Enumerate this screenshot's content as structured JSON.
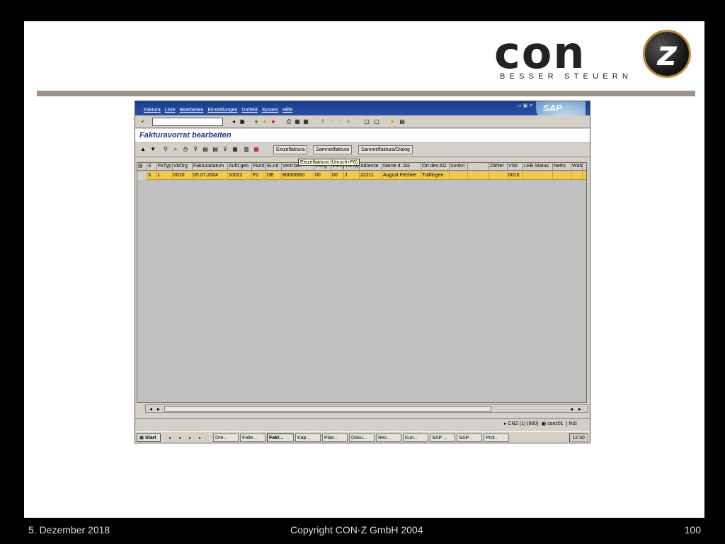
{
  "logo": {
    "name": "con",
    "letter": "z",
    "tagline": "BESSER STEUERN"
  },
  "sap": {
    "menu": [
      "Faktura",
      "Liste",
      "Bearbeiten",
      "Einstellungen",
      "Umfeld",
      "System",
      "Hilfe"
    ],
    "brand": "SAP",
    "page_title": "Fakturavorrat bearbeiten",
    "buttons": [
      "Einzelfaktura",
      "Sammelfaktura",
      "Sammelfaktura/Dialog"
    ],
    "tooltip": "Einzelfaktura   (Umsch+F6)",
    "columns": [
      "S",
      "FkTyp",
      "VkOrg",
      "Fakturadatum",
      "Auftr.geb",
      "FkArt",
      "ELnd",
      "Vertr.bel.",
      "VVeg",
      "VGVp",
      "VGTyp",
      "Adresse",
      "Name d. AG",
      "Ort des AG",
      "Sortkri",
      "",
      "Zähler",
      "VStl",
      "LEB Status",
      "Netto",
      "Wäh"
    ],
    "row": [
      "X",
      "L",
      "0010",
      "05.07.2004",
      "10022",
      "F2",
      "DE",
      "80000560",
      "00",
      "00",
      "J",
      "22211",
      "August Fechter",
      "Tuttlingen",
      "",
      "",
      "",
      "0010",
      "",
      "",
      ""
    ],
    "status": {
      "system": "CNZ (1) (800)",
      "user": "conz01",
      "mode": "INS"
    },
    "taskbar": {
      "start": "Start",
      "tasks": [
        "Dre...",
        "Folie...",
        "Fakt...",
        "Kap...",
        "Plan...",
        "Doku...",
        "Rec...",
        "Kun...",
        "SAP ...",
        "SAP...",
        "Prot..."
      ],
      "clock": "12:30"
    }
  },
  "footer": {
    "date": "5. Dezember 2018",
    "copyright": "Copyright CON-Z GmbH 2004",
    "page": "100"
  }
}
